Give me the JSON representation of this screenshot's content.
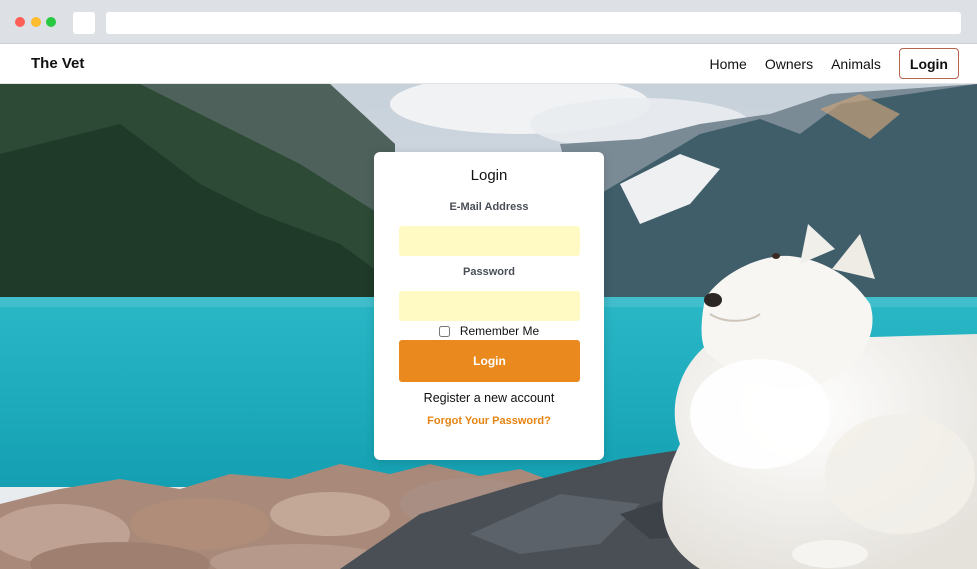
{
  "navbar": {
    "brand": "The Vet",
    "links": [
      "Home",
      "Owners",
      "Animals"
    ],
    "login": "Login"
  },
  "login_form": {
    "title": "Login",
    "email_label": "E-Mail Address",
    "email_value": "",
    "password_label": "Password",
    "password_value": "",
    "remember_label": "Remember Me",
    "remember_checked": false,
    "submit_label": "Login",
    "register_link": "Register a new account",
    "forgot_link": "Forgot Your Password?"
  },
  "colors": {
    "accent": "#ea8a1e",
    "forgot_link": "#e58412",
    "input_fill": "#fff9c4",
    "nav_login_border": "#b5654d"
  }
}
